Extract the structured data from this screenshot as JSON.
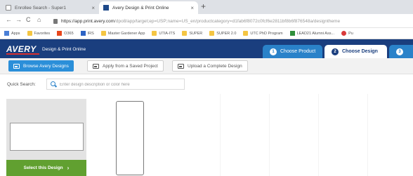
{
  "browser": {
    "tabs": [
      {
        "title": "Enrollee Search - Super1",
        "close": "×"
      },
      {
        "title": "Avery Design & Print Online",
        "close": "×"
      }
    ],
    "new_tab": "+",
    "nav": {
      "back": "←",
      "forward": "→",
      "reload": "C",
      "home": "⌂"
    },
    "address": {
      "host": "https://app.print.avery.com",
      "path": "/dpo8/app/target;ep=USP;name=US_en/productcategory=d1fab6f8072c0fcf6e2811bf8b6f876548a/designtheme"
    },
    "bookmarks": [
      {
        "label": "Apps",
        "icon": "apps-grid-icon"
      },
      {
        "label": "Favorites",
        "icon": "folder-icon"
      },
      {
        "label": "O365",
        "icon": "office-icon"
      },
      {
        "label": "IRS",
        "icon": "irs-icon"
      },
      {
        "label": "Master Gardener App",
        "icon": "folder-icon"
      },
      {
        "label": "UTIA-ITS",
        "icon": "folder-icon"
      },
      {
        "label": "SUPER",
        "icon": "folder-icon"
      },
      {
        "label": "SUPER 2.0",
        "icon": "folder-icon"
      },
      {
        "label": "UTC PhD Program",
        "icon": "folder-icon"
      },
      {
        "label": "LEAD21 Alumni Ass...",
        "icon": "leaf-icon"
      },
      {
        "label": "Pu",
        "icon": "circle-icon"
      }
    ]
  },
  "header": {
    "logo": "AVERY",
    "subtitle": "Design & Print Online",
    "steps": [
      {
        "num": "1",
        "label": "Choose Product",
        "state": "completed"
      },
      {
        "num": "2",
        "label": "Choose Design",
        "state": "active"
      },
      {
        "num": "3",
        "label": "",
        "state": "upcoming"
      }
    ]
  },
  "toolbar": {
    "browse": "Browse Avery Designs",
    "saved": "Apply from a Saved Project",
    "upload": "Upload a Complete Design"
  },
  "search": {
    "label": "Quick Search:",
    "placeholder": "Enter design description or color here"
  },
  "sidebar": {
    "select_button": "Select this Design",
    "chevron": "›"
  },
  "colors": {
    "header_bg": "#1a3e7e",
    "step_completed": "#2a82c9",
    "primary_button": "#2b8fd9",
    "select_button": "#61a030"
  }
}
